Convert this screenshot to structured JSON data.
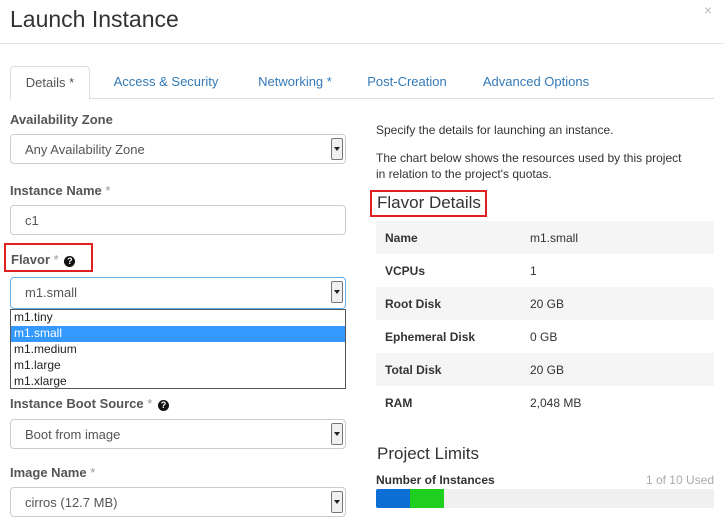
{
  "modal": {
    "title": "Launch Instance",
    "close": "×"
  },
  "tabs": [
    {
      "label": "Details *",
      "active": true
    },
    {
      "label": "Access & Security",
      "active": false
    },
    {
      "label": "Networking *",
      "active": false
    },
    {
      "label": "Post-Creation",
      "active": false
    },
    {
      "label": "Advanced Options",
      "active": false
    }
  ],
  "form": {
    "availability_zone": {
      "label": "Availability Zone",
      "value": "Any Availability Zone"
    },
    "instance_name": {
      "label": "Instance Name",
      "required": "*",
      "value": "c1"
    },
    "flavor": {
      "label": "Flavor",
      "required": "*",
      "value": "m1.small",
      "options": [
        "m1.tiny",
        "m1.small",
        "m1.medium",
        "m1.large",
        "m1.xlarge"
      ],
      "selected": "m1.small"
    },
    "boot_source": {
      "label": "Instance Boot Source",
      "required": "*",
      "value": "Boot from image"
    },
    "image_name": {
      "label": "Image Name",
      "required": "*",
      "value": "cirros (12.7 MB)"
    }
  },
  "help": {
    "line1": "Specify the details for launching an instance.",
    "line2": "The chart below shows the resources used by this project",
    "line3": "in relation to the project's quotas."
  },
  "flavor_details": {
    "title": "Flavor Details",
    "rows": [
      {
        "name": "Name",
        "value": "m1.small"
      },
      {
        "name": "VCPUs",
        "value": "1"
      },
      {
        "name": "Root Disk",
        "value": "20 GB"
      },
      {
        "name": "Ephemeral Disk",
        "value": "0 GB"
      },
      {
        "name": "Total Disk",
        "value": "20 GB"
      },
      {
        "name": "RAM",
        "value": "2,048 MB"
      }
    ]
  },
  "project_limits": {
    "title": "Project Limits",
    "instances_label": "Number of Instances",
    "instances_used": "1 of 10 Used",
    "used_fraction": 0.1,
    "new_fraction": 0.1,
    "colors": {
      "used": "#0d6fd6",
      "new": "#1fcf1f"
    }
  },
  "icon": {
    "help": "?"
  }
}
